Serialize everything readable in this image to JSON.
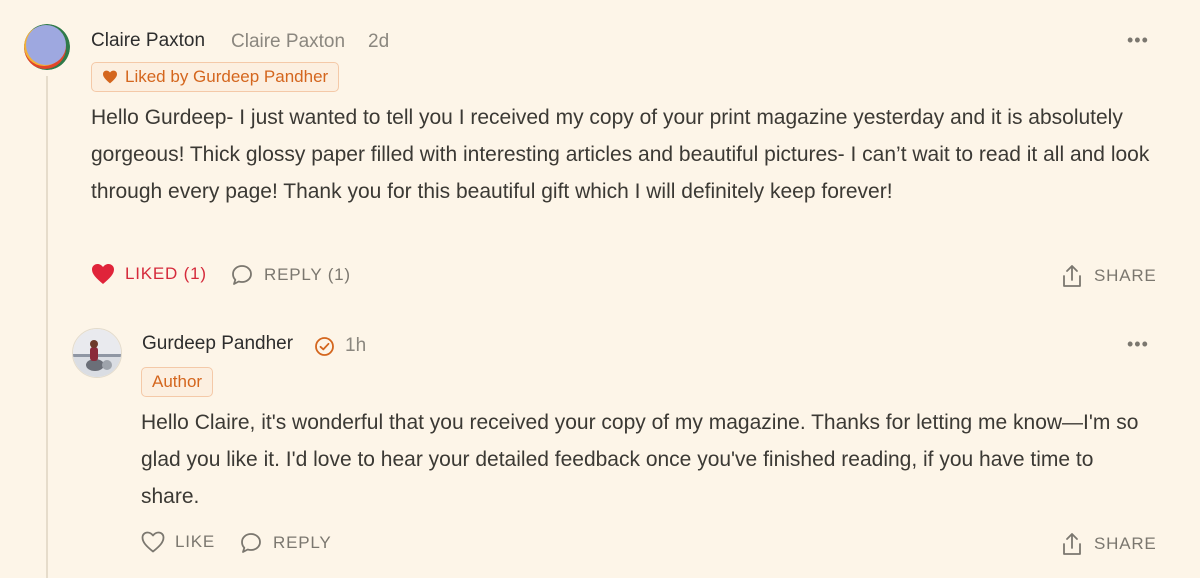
{
  "colors": {
    "background": "#fdf5e8",
    "accent": "#d4661e",
    "liked": "#e0243a",
    "muted": "#7b776f"
  },
  "comment": {
    "author": "Claire Paxton",
    "handle": "Claire Paxton",
    "time": "2d",
    "liked_badge": "Liked by Gurdeep Pandher",
    "body": "Hello Gurdeep- I just wanted to tell you I received my copy of your print magazine yesterday and it is absolutely gorgeous! Thick glossy paper filled with interesting articles and beautiful pictures- I can’t wait to read it all and look through every page! Thank you for this beautiful gift which I will definitely keep forever!",
    "actions": {
      "like": "LIKED (1)",
      "reply": "REPLY (1)",
      "share": "SHARE"
    }
  },
  "reply": {
    "author": "Gurdeep Pandher",
    "time": "1h",
    "badge": "Author",
    "body": "Hello Claire, it's wonderful that you received your copy of my magazine. Thanks for letting me know—I'm so glad you like it. I'd love to hear your detailed feedback once you've finished reading, if you have time to share.",
    "actions": {
      "like": "LIKE",
      "reply": "REPLY",
      "share": "SHARE"
    }
  },
  "icons": [
    "heart-icon",
    "comment-icon",
    "share-icon",
    "more-icon",
    "verified-icon"
  ]
}
